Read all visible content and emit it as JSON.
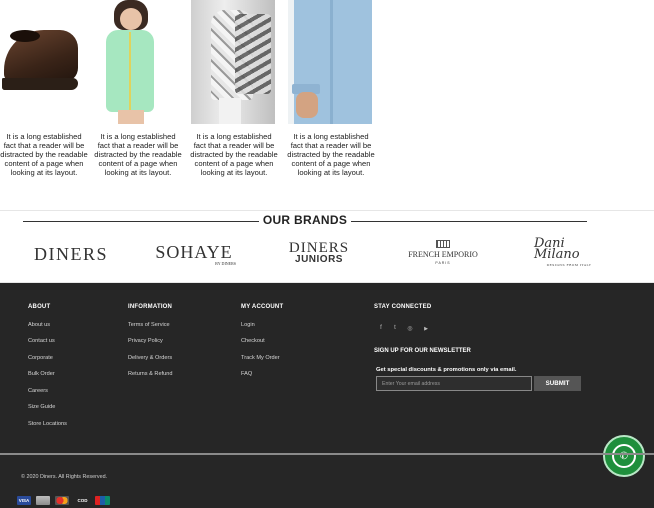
{
  "products": [
    {
      "image": "loafer-shoe",
      "caption": "It is a long established fact that a reader will be distracted by the readable content of a page when looking at its layout."
    },
    {
      "image": "girl-mint-kurta",
      "caption": "It is a long established fact that a reader will be distracted by the readable content of a page when looking at its layout."
    },
    {
      "image": "woman-printed-suit",
      "caption": "It is a long established fact that a reader will be distracted by the readable content of a page when looking at its layout."
    },
    {
      "image": "man-blue-shirt",
      "caption": "It is a long established fact that a reader will be distracted by the readable content of a page when looking at its layout."
    }
  ],
  "brands": {
    "title": "OUR BRANDS",
    "logos": [
      {
        "name": "DINERS"
      },
      {
        "name": "SOHAYE",
        "sub": "BY DINERS"
      },
      {
        "name": "DINERS",
        "sub": "JUNIORS"
      },
      {
        "name": "FRENCH EMPORIO",
        "sub": "PARIS"
      },
      {
        "name": "Dani Milano",
        "sub": "DESIGNS FROM ITALY"
      }
    ]
  },
  "footer": {
    "about": {
      "heading": "ABOUT",
      "links": [
        "About us",
        "Contact us",
        "Corporate",
        "Bulk Order",
        "Careers",
        "Size Guide",
        "Store Locations"
      ]
    },
    "information": {
      "heading": "INFORMATION",
      "links": [
        "Terms of Service",
        "Privacy Policy",
        "Delivery & Orders",
        "Returns & Refund"
      ]
    },
    "account": {
      "heading": "MY ACCOUNT",
      "links": [
        "Login",
        "Checkout",
        "Track My Order",
        "FAQ"
      ]
    },
    "stay_connected": {
      "heading": "STAY CONNECTED",
      "icons": [
        {
          "name": "facebook-icon",
          "glyph": "f"
        },
        {
          "name": "twitter-icon",
          "glyph": "t"
        },
        {
          "name": "instagram-icon",
          "glyph": "◎"
        },
        {
          "name": "youtube-icon",
          "glyph": "▶"
        }
      ]
    },
    "newsletter": {
      "heading": "SIGN UP FOR OUR NEWSLETTER",
      "subheading": "Get special discounts & promotions only via email.",
      "placeholder": "Enter Your email address",
      "button": "SUBMIT"
    },
    "copyright": "© 2020 Diners. All Rights Reserved.",
    "payments": [
      {
        "label": "VISA",
        "color": "#2a4b9b"
      },
      {
        "label": "",
        "color": "#9a9a9a"
      },
      {
        "label": "",
        "color": "#e4312b"
      },
      {
        "label": "COD",
        "color": "#262626"
      },
      {
        "label": "",
        "color": "#1c5da8"
      }
    ]
  },
  "colors": {
    "footer_bg": "#262626",
    "whatsapp": "#1f8f3c"
  }
}
